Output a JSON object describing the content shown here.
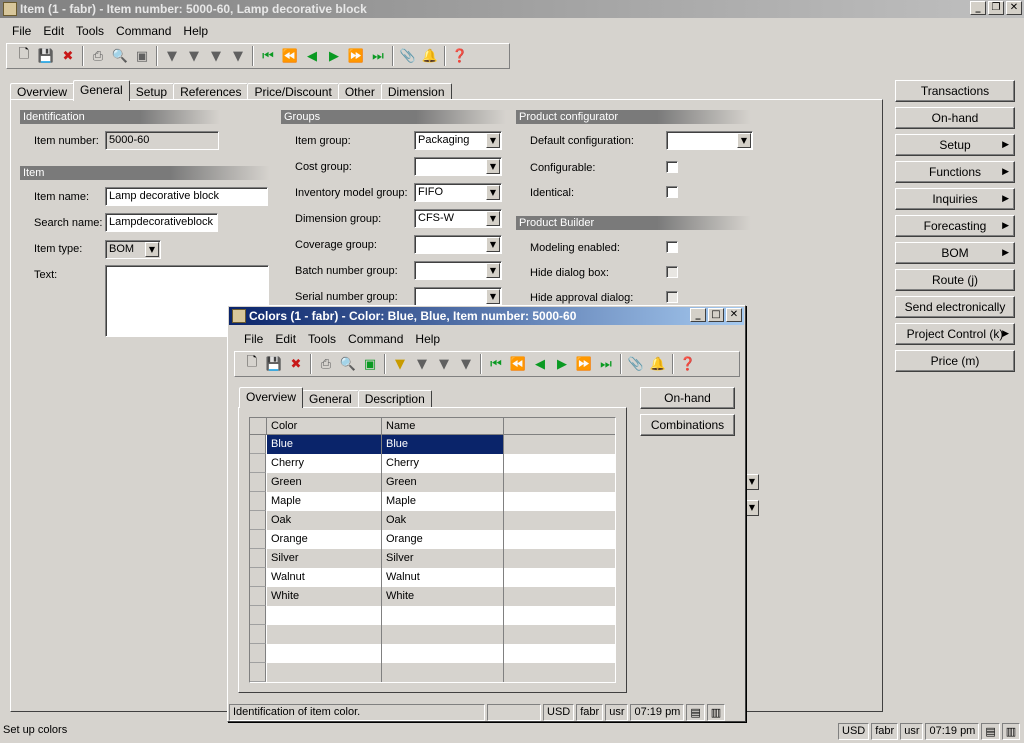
{
  "main_window": {
    "title": "Item (1 - fabr) - Item number: 5000-60, Lamp decorative block",
    "menu": [
      "File",
      "Edit",
      "Tools",
      "Command",
      "Help"
    ],
    "tabs": [
      "Overview",
      "General",
      "Setup",
      "References",
      "Price/Discount",
      "Other",
      "Dimension"
    ],
    "active_tab": "General",
    "identification": {
      "heading": "Identification",
      "item_number_label": "Item number:",
      "item_number_value": "5000-60"
    },
    "item": {
      "heading": "Item",
      "item_name_label": "Item name:",
      "item_name_value": "Lamp decorative block",
      "search_name_label": "Search name:",
      "search_name_value": "Lampdecorativeblock",
      "item_type_label": "Item type:",
      "item_type_value": "BOM",
      "text_label": "Text:"
    },
    "groups": {
      "heading": "Groups",
      "item_group_label": "Item group:",
      "item_group_value": "Packaging",
      "cost_group_label": "Cost group:",
      "cost_group_value": "",
      "inventory_model_group_label": "Inventory model group:",
      "inventory_model_group_value": "FIFO",
      "dimension_group_label": "Dimension group:",
      "dimension_group_value": "CFS-W",
      "coverage_group_label": "Coverage group:",
      "coverage_group_value": "",
      "batch_number_group_label": "Batch number group:",
      "batch_number_group_value": "",
      "serial_number_group_label": "Serial number group:",
      "serial_number_group_value": ""
    },
    "product_configurator": {
      "heading": "Product configurator",
      "default_configuration_label": "Default configuration:",
      "default_configuration_value": "",
      "configurable_label": "Configurable:",
      "identical_label": "Identical:"
    },
    "product_builder": {
      "heading": "Product Builder",
      "modeling_enabled_label": "Modeling enabled:",
      "hide_dialog_box_label": "Hide dialog box:",
      "hide_approval_dialog_label": "Hide approval dialog:"
    },
    "side_buttons": [
      {
        "label": "Transactions",
        "has_arrow": false
      },
      {
        "label": "On-hand",
        "has_arrow": false
      },
      {
        "label": "Setup",
        "has_arrow": true
      },
      {
        "label": "Functions",
        "has_arrow": true
      },
      {
        "label": "Inquiries",
        "has_arrow": true
      },
      {
        "label": "Forecasting",
        "has_arrow": true
      },
      {
        "label": "BOM",
        "has_arrow": true
      },
      {
        "label": "Route (j)",
        "has_arrow": false
      },
      {
        "label": "Send electronically",
        "has_arrow": false
      },
      {
        "label": "Project Control (k)",
        "has_arrow": true
      },
      {
        "label": "Price (m)",
        "has_arrow": false
      }
    ],
    "status": {
      "message": "Set up colors",
      "currency": "USD",
      "company": "fabr",
      "user": "usr",
      "time": "07:19 pm"
    }
  },
  "colors_dialog": {
    "title": "Colors (1 - fabr) - Color: Blue, Blue, Item number: 5000-60",
    "menu": [
      "File",
      "Edit",
      "Tools",
      "Command",
      "Help"
    ],
    "tabs": [
      "Overview",
      "General",
      "Description"
    ],
    "active_tab": "Overview",
    "buttons": [
      "On-hand",
      "Combinations"
    ],
    "grid": {
      "columns": [
        "Color",
        "Name"
      ],
      "rows": [
        {
          "color": "Blue",
          "name": "Blue"
        },
        {
          "color": "Cherry",
          "name": "Cherry"
        },
        {
          "color": "Green",
          "name": "Green"
        },
        {
          "color": "Maple",
          "name": "Maple"
        },
        {
          "color": "Oak",
          "name": "Oak"
        },
        {
          "color": "Orange",
          "name": "Orange"
        },
        {
          "color": "Silver",
          "name": "Silver"
        },
        {
          "color": "Walnut",
          "name": "Walnut"
        },
        {
          "color": "White",
          "name": "White"
        }
      ],
      "selected_row": 0
    },
    "status": {
      "message": "Identification of item color.",
      "currency": "USD",
      "company": "fabr",
      "user": "usr",
      "time": "07:19 pm"
    }
  }
}
